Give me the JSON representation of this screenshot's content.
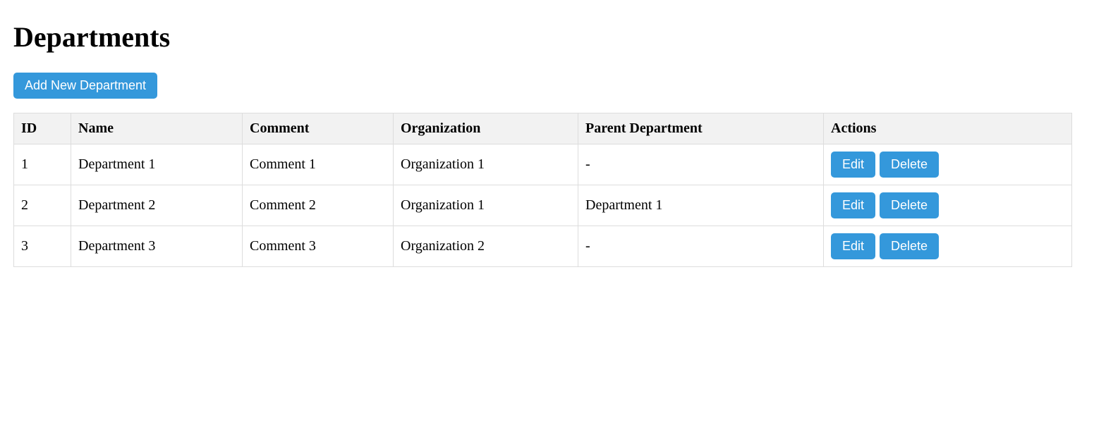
{
  "page": {
    "title": "Departments",
    "add_button_label": "Add New Department"
  },
  "theme": {
    "accent": "#3498db",
    "header_bg": "#f2f2f2",
    "border": "#dddddd"
  },
  "table": {
    "headers": {
      "id": "ID",
      "name": "Name",
      "comment": "Comment",
      "organization": "Organization",
      "parent": "Parent Department",
      "actions": "Actions"
    },
    "rows": [
      {
        "id": "1",
        "name": "Department 1",
        "comment": "Comment 1",
        "organization": "Organization 1",
        "parent": "-",
        "edit_label": "Edit",
        "delete_label": "Delete"
      },
      {
        "id": "2",
        "name": "Department 2",
        "comment": "Comment 2",
        "organization": "Organization 1",
        "parent": "Department 1",
        "edit_label": "Edit",
        "delete_label": "Delete"
      },
      {
        "id": "3",
        "name": "Department 3",
        "comment": "Comment 3",
        "organization": "Organization 2",
        "parent": "-",
        "edit_label": "Edit",
        "delete_label": "Delete"
      }
    ]
  }
}
